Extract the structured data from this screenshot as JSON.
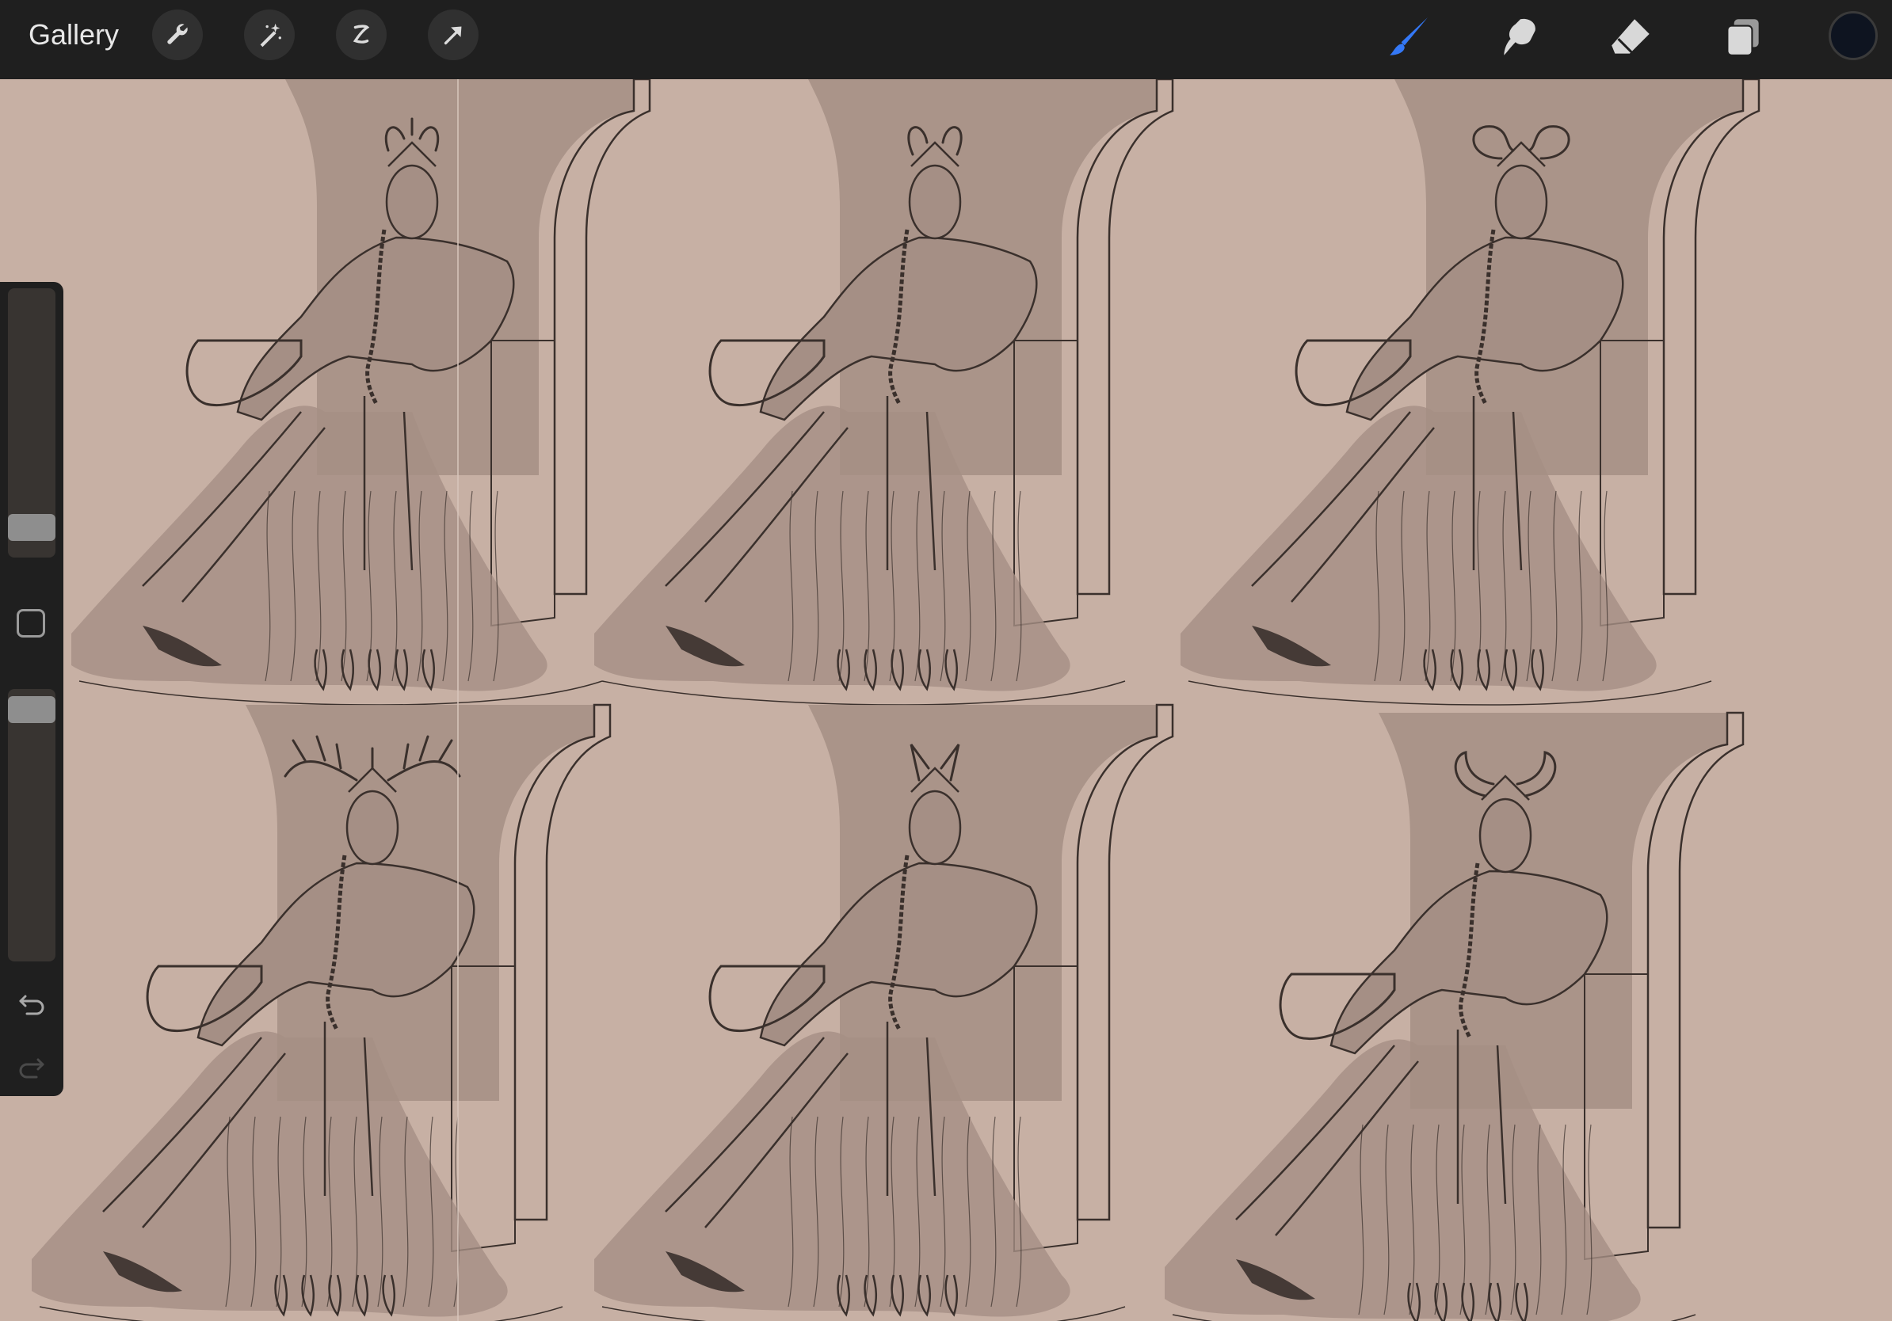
{
  "topbar": {
    "gallery_label": "Gallery",
    "left_tools": [
      {
        "name": "wrench-icon"
      },
      {
        "name": "magic-wand-icon"
      },
      {
        "name": "selection-icon"
      },
      {
        "name": "transform-arrow-icon"
      }
    ],
    "right_tools": [
      {
        "name": "brush-icon",
        "color": "#3478f6"
      },
      {
        "name": "smudge-icon",
        "color": "#d8d8d8"
      },
      {
        "name": "eraser-icon",
        "color": "#d8d8d8"
      },
      {
        "name": "layers-icon",
        "color": "#d8d8d8"
      }
    ],
    "current_color": "#0e1420"
  },
  "sidebar": {
    "brush_size_level": 0.07,
    "opacity_level": 0.97,
    "icons": [
      "modify-button",
      "undo-icon",
      "redo-icon"
    ]
  },
  "canvas": {
    "background_color": "#c7b0a4",
    "shadow_color": "#a58f85",
    "line_color": "#3a302c",
    "sketches": [
      {
        "headpiece": "swept-horns"
      },
      {
        "headpiece": "curved-horns"
      },
      {
        "headpiece": "ram-horns"
      },
      {
        "headpiece": "antlers"
      },
      {
        "headpiece": "pointed-horns"
      },
      {
        "headpiece": "bull-horns"
      }
    ]
  }
}
